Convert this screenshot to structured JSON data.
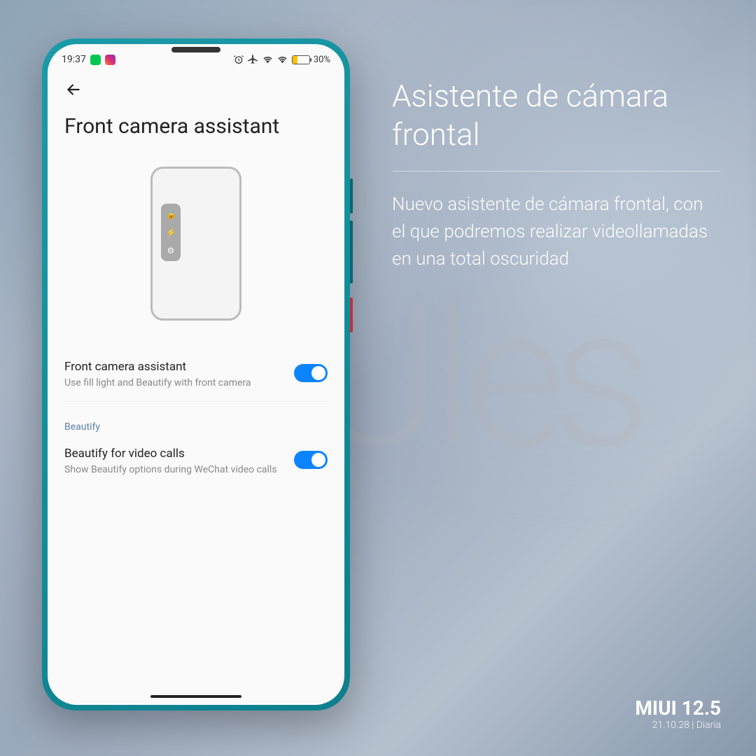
{
  "statusbar": {
    "time": "19:37",
    "battery_pct": "30%"
  },
  "page": {
    "title": "Front camera assistant"
  },
  "settings": {
    "fca": {
      "title": "Front camera assistant",
      "desc": "Use fill light and Beautify with front camera",
      "on": true
    },
    "section_beautify": "Beautify",
    "beautify_calls": {
      "title": "Beautify for video calls",
      "desc": "Show Beautify options during WeChat video calls",
      "on": true
    }
  },
  "promo": {
    "title": "Asistente de cámara frontal",
    "desc": "Nuevo asistente de cámara frontal, con el que podremos realizar videollamadas en una total oscuridad"
  },
  "footer": {
    "brand": "MIUI 12.5",
    "build": "21.10.28 | Diaria"
  },
  "watermark": "MIUIes"
}
